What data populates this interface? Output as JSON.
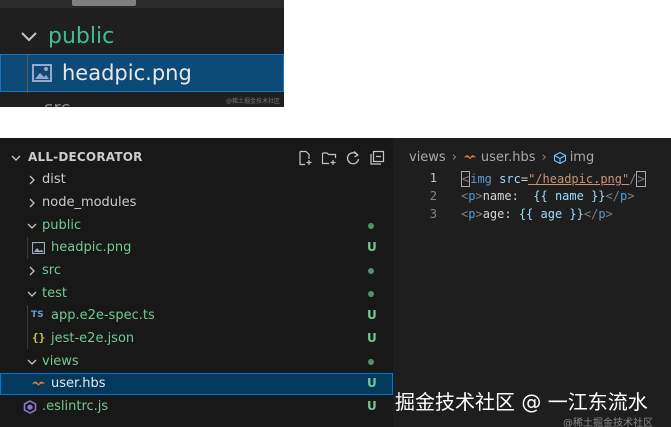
{
  "zoom": {
    "folder_label": "public",
    "file_label": "headpic.png",
    "partial_label": "src",
    "watermark": "@稀土掘金技术社区"
  },
  "explorer": {
    "title": "ALL-DECORATOR",
    "actions": [
      "new-file-icon",
      "new-folder-icon",
      "refresh-icon",
      "collapse-all-icon"
    ],
    "items": [
      {
        "label": "dist",
        "type": "folder",
        "expanded": false,
        "status": ""
      },
      {
        "label": "node_modules",
        "type": "folder",
        "expanded": false,
        "status": ""
      },
      {
        "label": "public",
        "type": "folder",
        "expanded": true,
        "status": "dot"
      },
      {
        "label": "headpic.png",
        "type": "file",
        "icon": "image-icon",
        "status": "U"
      },
      {
        "label": "src",
        "type": "folder",
        "expanded": false,
        "status": "dot"
      },
      {
        "label": "test",
        "type": "folder",
        "expanded": true,
        "status": "dot"
      },
      {
        "label": "app.e2e-spec.ts",
        "type": "file",
        "icon": "typescript-icon",
        "icon_text": "TS",
        "status": "U"
      },
      {
        "label": "jest-e2e.json",
        "type": "file",
        "icon": "json-icon",
        "icon_text": "{}",
        "status": "U"
      },
      {
        "label": "views",
        "type": "folder",
        "expanded": true,
        "status": "dot"
      },
      {
        "label": "user.hbs",
        "type": "file",
        "icon": "handlebars-icon",
        "status": "U",
        "selected": true
      },
      {
        "label": ".eslintrc.js",
        "type": "file",
        "icon": "eslint-icon",
        "status": "U"
      }
    ]
  },
  "editor": {
    "breadcrumb": [
      "views",
      "user.hbs",
      "img"
    ],
    "lines": [
      {
        "n": "1",
        "parts": [
          [
            "br",
            "<"
          ],
          [
            "tag",
            "img"
          ],
          [
            "txt",
            " "
          ],
          [
            "attr",
            "src"
          ],
          [
            "txt",
            "="
          ],
          [
            "str",
            "\"/headpic.png\""
          ],
          [
            "br",
            "/"
          ],
          [
            "br",
            ">"
          ]
        ]
      },
      {
        "n": "2",
        "parts": [
          [
            "br",
            "<"
          ],
          [
            "tag",
            "p"
          ],
          [
            "br",
            ">"
          ],
          [
            "txt",
            "name:  "
          ],
          [
            "hbs",
            "{{ name }}"
          ],
          [
            "br",
            "</"
          ],
          [
            "tag",
            "p"
          ],
          [
            "br",
            ">"
          ]
        ]
      },
      {
        "n": "3",
        "parts": [
          [
            "br",
            "<"
          ],
          [
            "tag",
            "p"
          ],
          [
            "br",
            ">"
          ],
          [
            "txt",
            "age: "
          ],
          [
            "hbs",
            "{{ age }}"
          ],
          [
            "br",
            "</"
          ],
          [
            "tag",
            "p"
          ],
          [
            "br",
            ">"
          ]
        ]
      }
    ]
  },
  "watermark": {
    "main": "掘金技术社区 @ 一江东流水",
    "small": "@稀土掘金技术社区"
  },
  "colors": {
    "explorer_bg": "#181818",
    "editor_bg": "#1e1e1e",
    "selection_bg": "#04395e",
    "git_untracked": "#73c991",
    "folder_green": "#3fbf8f"
  }
}
